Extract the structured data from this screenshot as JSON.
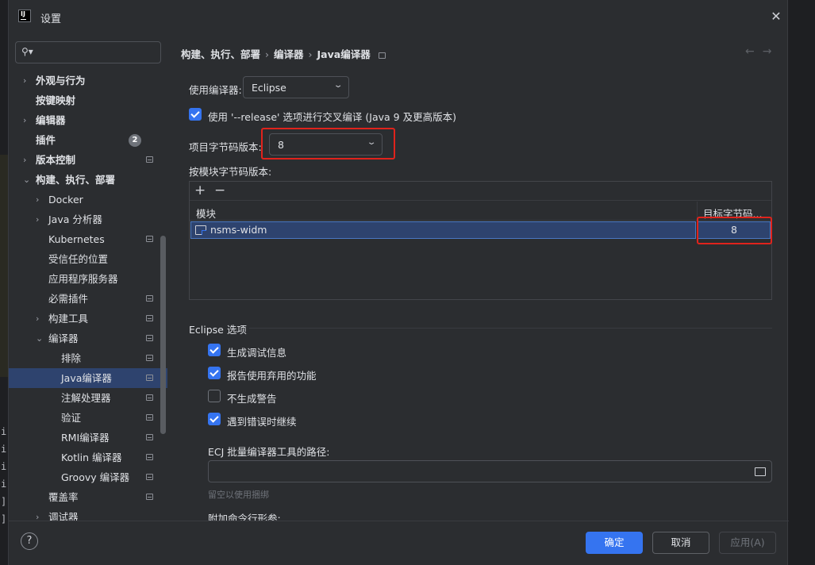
{
  "dialog": {
    "title": "设置"
  },
  "sidebar": {
    "search_placeholder": "",
    "items": [
      {
        "label": "外观与行为",
        "bold": true,
        "arrow": "›"
      },
      {
        "label": "按键映射",
        "bold": true
      },
      {
        "label": "编辑器",
        "bold": true,
        "arrow": "›"
      },
      {
        "label": "插件",
        "bold": true,
        "badge": "2"
      },
      {
        "label": "版本控制",
        "bold": true,
        "arrow": "›"
      },
      {
        "label": "构建、执行、部署",
        "bold": true,
        "arrow": "⌄"
      },
      {
        "label": "Docker",
        "arrow": "›"
      },
      {
        "label": "Java 分析器",
        "arrow": "›"
      },
      {
        "label": "Kubernetes"
      },
      {
        "label": "受信任的位置"
      },
      {
        "label": "应用程序服务器"
      },
      {
        "label": "必需插件"
      },
      {
        "label": "构建工具",
        "arrow": "›"
      },
      {
        "label": "编译器",
        "arrow": "⌄"
      },
      {
        "label": "排除"
      },
      {
        "label": "Java编译器",
        "selected": true
      },
      {
        "label": "注解处理器"
      },
      {
        "label": "验证"
      },
      {
        "label": "RMI编译器"
      },
      {
        "label": "Kotlin 编译器"
      },
      {
        "label": "Groovy 编译器"
      },
      {
        "label": "覆盖率"
      },
      {
        "label": "调试器",
        "arrow": "›"
      }
    ]
  },
  "breadcrumb": {
    "part1": "构建、执行、部署",
    "part2": "编译器",
    "part3": "Java编译器",
    "sep": "›"
  },
  "nav": {
    "back": "←",
    "forward": "→"
  },
  "compiler": {
    "label": "使用编译器:",
    "value": "Eclipse",
    "release_option": "使用 '--release' 选项进行交叉编译 (Java 9 及更高版本)",
    "bytecode_label": "项目字节码版本:",
    "bytecode_value": "8",
    "per_module_label": "按模块字节码版本:"
  },
  "module_table": {
    "col_module": "模块",
    "col_target": "目标字节码...",
    "rows": [
      {
        "module": "nsms-widm",
        "target": "8"
      }
    ]
  },
  "eclipse": {
    "group_title": "Eclipse 选项",
    "options": [
      {
        "label": "生成调试信息",
        "checked": true
      },
      {
        "label": "报告使用弃用的功能",
        "checked": true
      },
      {
        "label": "不生成警告",
        "checked": false
      },
      {
        "label": "遇到错误时继续",
        "checked": true
      }
    ],
    "ecj_label": "ECJ 批量编译器工具的路径:",
    "ecj_value": "",
    "ecj_hint": "留空以使用捆绑",
    "extra_args_label": "附加命令行形参:"
  },
  "footer": {
    "help": "?",
    "ok": "确定",
    "cancel": "取消",
    "apply": "应用(A)"
  },
  "background_code": [
    "i",
    "i",
    "i",
    "i",
    "]",
    "]"
  ],
  "colors": {
    "accent": "#3574f0",
    "selection": "#2e436e",
    "highlight": "#e0231c"
  }
}
